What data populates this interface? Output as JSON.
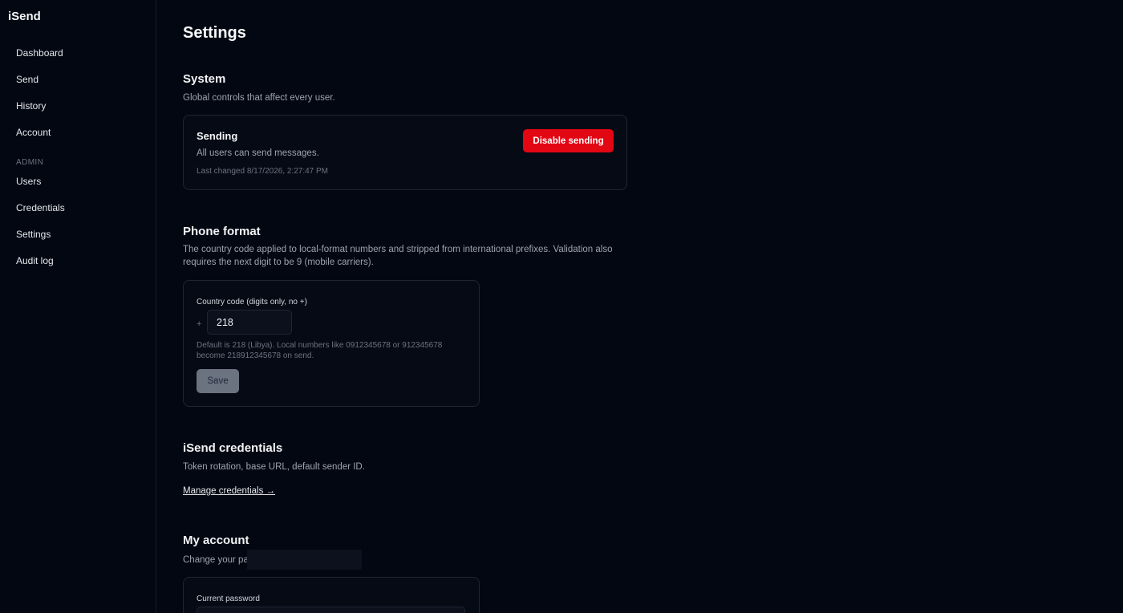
{
  "app": {
    "brand": "iSend"
  },
  "sidebar": {
    "items": [
      {
        "label": "Dashboard"
      },
      {
        "label": "Send"
      },
      {
        "label": "History"
      },
      {
        "label": "Account"
      }
    ],
    "admin_section": "ADMIN",
    "admin_items": [
      {
        "label": "Users"
      },
      {
        "label": "Credentials"
      },
      {
        "label": "Settings"
      },
      {
        "label": "Audit log"
      }
    ]
  },
  "page": {
    "title": "Settings"
  },
  "system": {
    "title": "System",
    "description": "Global controls that affect every user.",
    "sending": {
      "title": "Sending",
      "status": "All users can send messages.",
      "last_changed": "Last changed 8/17/2026, 2:27:47 PM",
      "button_label": "Disable sending",
      "button_color": "#e30613"
    }
  },
  "phone_format": {
    "title": "Phone format",
    "description": "The country code applied to local-format numbers and stripped from international prefixes. Validation also requires the next digit to be 9 (mobile carriers).",
    "field_label": "Country code (digits only, no +)",
    "prefix": "+",
    "value": "218",
    "hint": "Default is 218 (Libya). Local numbers like 0912345678 or 912345678 become 218912345678 on send.",
    "save_label": "Save"
  },
  "credentials": {
    "title": "iSend credentials",
    "description": "Token rotation, base URL, default sender ID.",
    "link_label": "Manage credentials →"
  },
  "my_account": {
    "title": "My account",
    "description": "Change your pa",
    "field_label": "Current password"
  }
}
